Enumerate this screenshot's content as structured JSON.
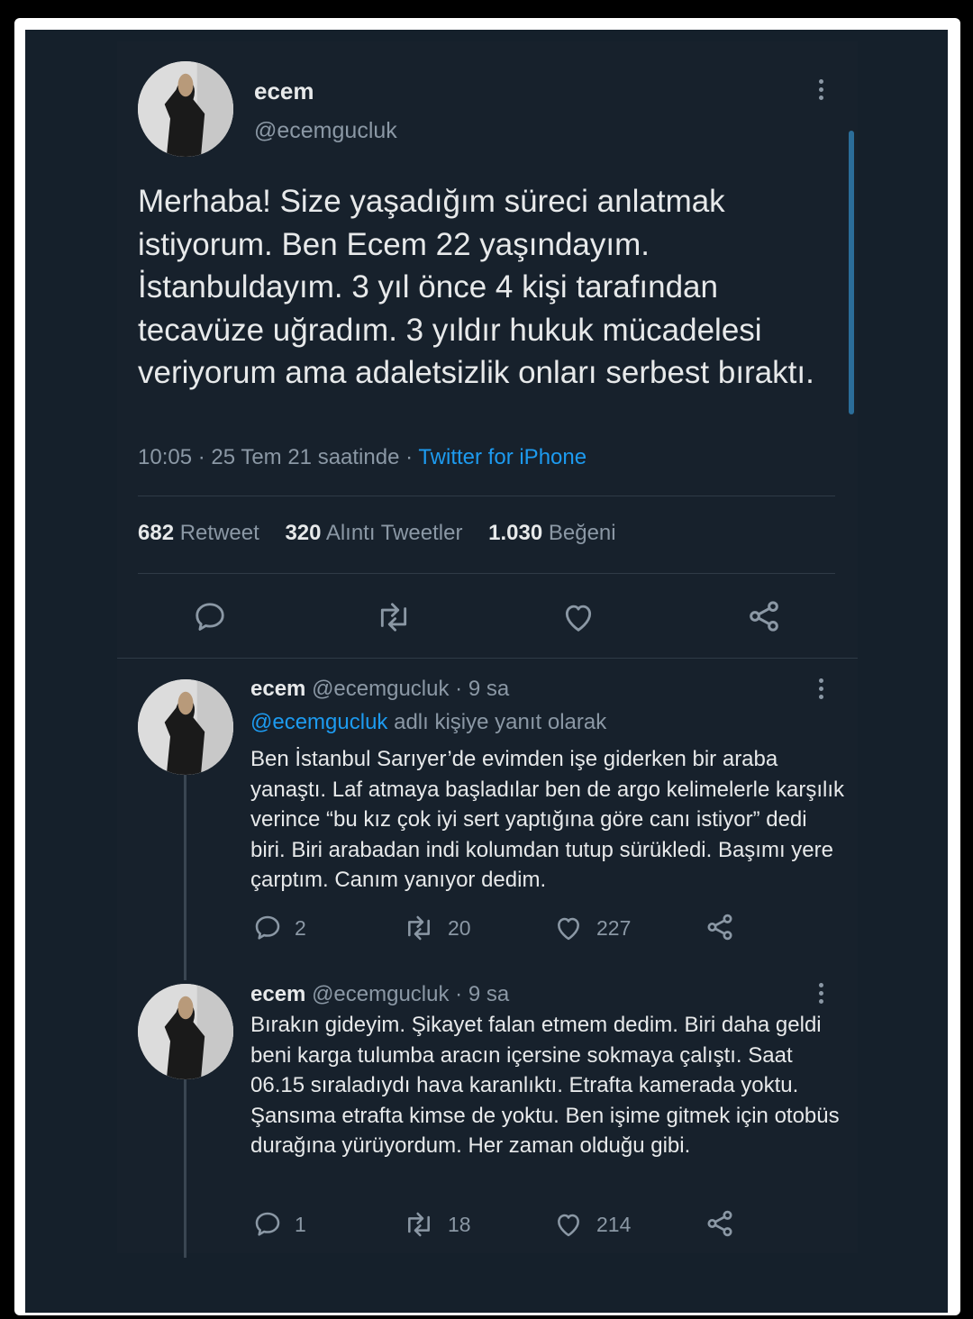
{
  "colors": {
    "background": "#15202b",
    "text": "#e7e9ea",
    "muted": "#8b98a5",
    "link": "#1d9bf0"
  },
  "main_tweet": {
    "name": "ecem",
    "handle": "@ecemgucluk",
    "text": "Merhaba! Size yaşadığım süreci anlatmak istiyorum. Ben Ecem 22 yaşındayım. İstanbuldayım. 3 yıl önce 4 kişi tarafından tecavüze uğradım. 3 yıldır hukuk mücadelesi veriyorum ama adaletsizlik onları serbest bıraktı.",
    "time": "10:05 · 25 Tem 21 saatinde ·",
    "source": "Twitter for iPhone",
    "stats": {
      "retweets": "682",
      "retweets_label": "Retweet",
      "quotes": "320",
      "quotes_label": "Alıntı Tweetler",
      "likes": "1.030",
      "likes_label": "Beğeni"
    },
    "actions": [
      "reply-icon",
      "retweet-icon",
      "like-icon",
      "share-icon"
    ]
  },
  "replies": [
    {
      "name": "ecem",
      "handle": "@ecemgucluk",
      "time": "· 9 sa",
      "reply_mention": "@ecemgucluk",
      "reply_suffix": "adlı kişiye yanıt olarak",
      "text": "Ben İstanbul Sarıyer’de evimden işe giderken bir araba yanaştı. Laf atmaya başladılar ben de argo kelimelerle karşılık verince “bu kız çok iyi sert yaptığına göre canı istiyor” dedi biri. Biri arabadan indi kolumdan tutup sürükledi. Başımı yere çarptım. Canım yanıyor dedim.",
      "replies": "2",
      "retweets": "20",
      "likes": "227"
    },
    {
      "name": "ecem",
      "handle": "@ecemgucluk",
      "time": "· 9 sa",
      "text": "Bırakın gideyim. Şikayet falan etmem dedim. Biri daha geldi beni karga tulumba aracın içersine sokmaya çalıştı. Saat 06.15 sıraladıydı hava karanlıktı. Etrafta kamerada yoktu. Şansıma etrafta kimse de yoktu. Ben işime gitmek için otobüs durağına yürüyordum. Her zaman olduğu gibi.",
      "replies": "1",
      "retweets": "18",
      "likes": "214"
    }
  ]
}
